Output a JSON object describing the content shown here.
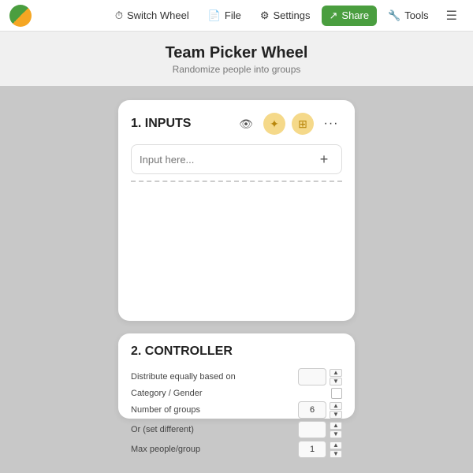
{
  "app": {
    "logo_alt": "App Logo"
  },
  "navbar": {
    "switch_wheel_label": "Switch Wheel",
    "file_label": "File",
    "settings_label": "Settings",
    "share_label": "Share",
    "tools_label": "Tools"
  },
  "page": {
    "title": "Team Picker Wheel",
    "subtitle": "Randomize people into groups"
  },
  "inputs_card": {
    "section_number": "1.",
    "section_title": "INPUTS",
    "input_placeholder": "Input here...",
    "add_btn_label": "+",
    "eye_icon": "👁",
    "filter_icon": "⚙",
    "grid_icon": "☰",
    "more_icon": "···"
  },
  "controller_card": {
    "section_number": "2.",
    "section_title": "CONTROLLER",
    "rows": [
      {
        "label": "Distribute equally based on",
        "control_type": "checkbox",
        "value": ""
      },
      {
        "label": "Category / Gender",
        "control_type": "checkbox",
        "value": ""
      },
      {
        "label": "Number of groups",
        "control_type": "stepper",
        "value": "6"
      },
      {
        "label": "Or (set different)",
        "control_type": "stepper",
        "value": ""
      },
      {
        "label": "Max people/group",
        "control_type": "stepper",
        "value": "1"
      }
    ]
  }
}
